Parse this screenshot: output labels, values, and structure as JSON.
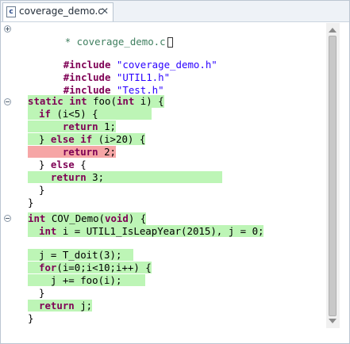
{
  "tab": {
    "title": "coverage_demo.c",
    "icon": "c-file-icon",
    "close": "✕"
  },
  "header_line": "* coverage_demo.c",
  "includes": [
    {
      "directive": "#include",
      "file": "\"coverage_demo.h\""
    },
    {
      "directive": "#include",
      "file": "\"UTIL1.h\""
    },
    {
      "directive": "#include",
      "file": "\"Test.h\""
    }
  ],
  "code": {
    "l1": {
      "kw1": "static",
      "kw2": "int",
      "rest": " foo(",
      "kw3": "int",
      "rest2": " i) {"
    },
    "l2": {
      "kw": "if",
      "rest": " (i<5) {"
    },
    "l3": {
      "kw": "return",
      "rest": " 1;"
    },
    "l4": {
      "pre": "} ",
      "kw1": "else",
      "mid": " ",
      "kw2": "if",
      "rest": " (i>20) {"
    },
    "l5": {
      "kw": "return",
      "rest": " 2;"
    },
    "l6": {
      "pre": "} ",
      "kw": "else",
      "rest": " {"
    },
    "l7": {
      "kw": "return",
      "rest": " 3;"
    },
    "l8": "}",
    "l9": "}",
    "l10": {
      "kw1": "int",
      "rest": " COV_Demo(",
      "kw2": "void",
      "rest2": ") {"
    },
    "l11": {
      "kw": "int",
      "rest": " i = UTIL1_IsLeapYear(2015), j = 0;"
    },
    "l12": "j = T_doit(3);",
    "l13": {
      "kw": "for",
      "rest": "(i=0;i<10;i++) {"
    },
    "l14": "j += foo(i);",
    "l15": "}",
    "l16": {
      "kw": "return",
      "rest": " j;"
    },
    "l17": "}"
  },
  "colors": {
    "covered": "#bdf5b6",
    "not_covered": "#f6a6a6",
    "keyword": "#7f0055",
    "string": "#2a00ff"
  }
}
